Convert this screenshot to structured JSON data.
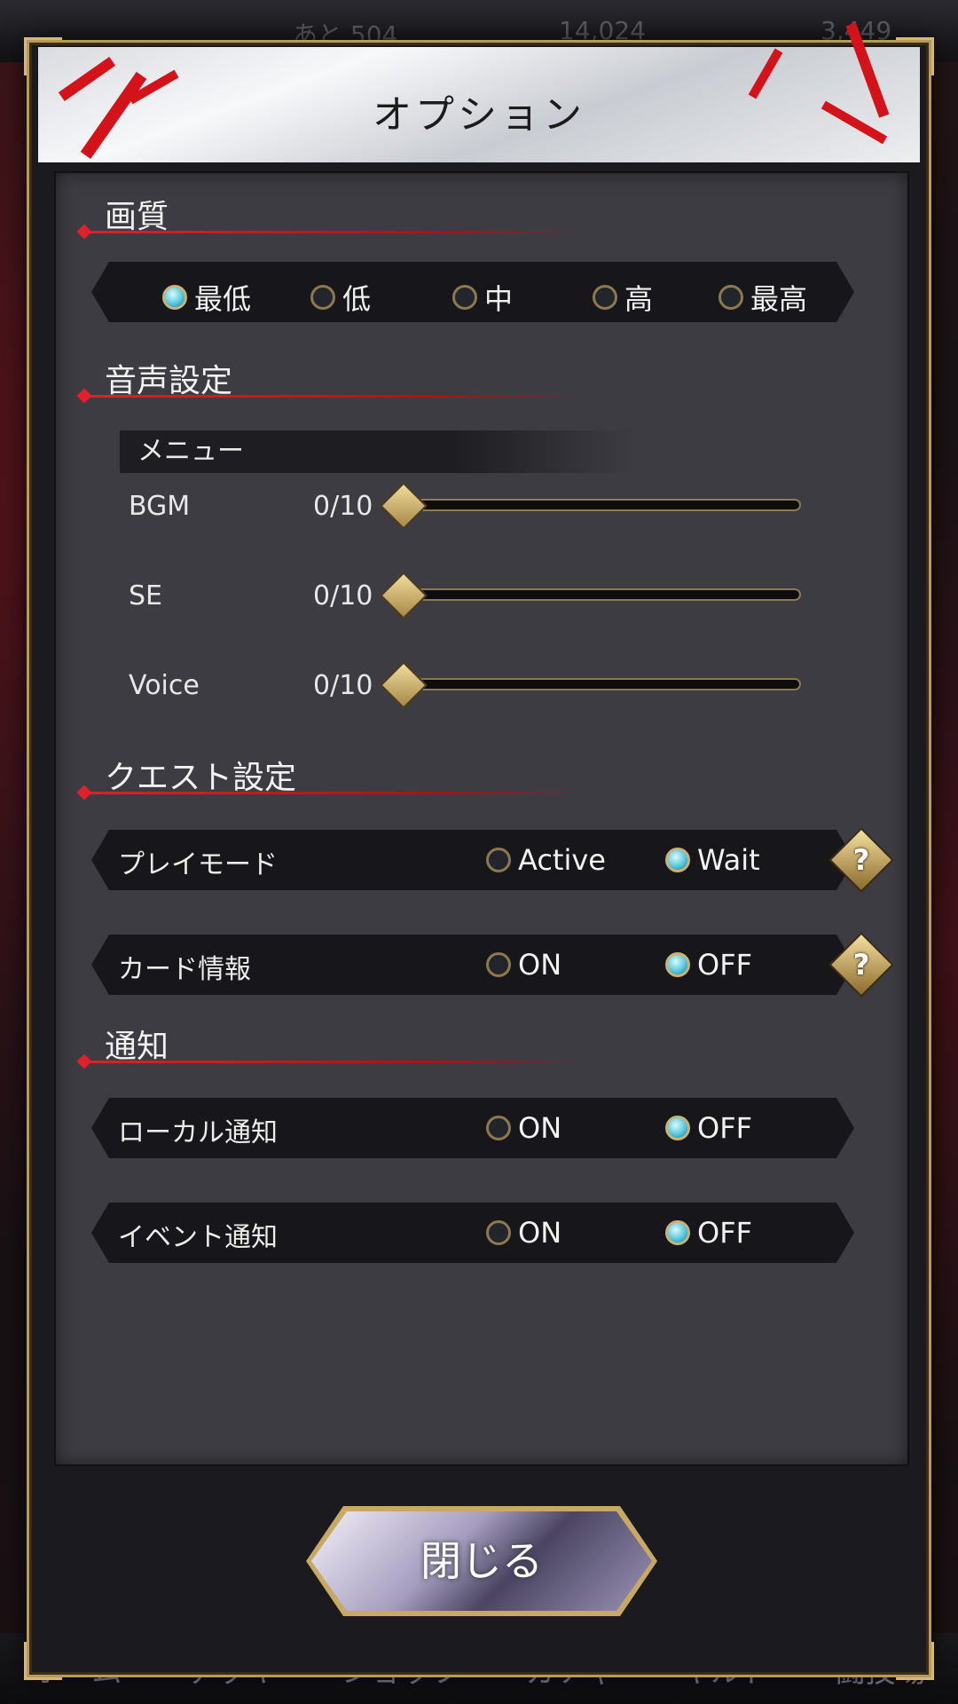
{
  "title": "オプション",
  "quality": {
    "heading": "画質",
    "options": [
      {
        "label": "最低",
        "selected": true
      },
      {
        "label": "低",
        "selected": false
      },
      {
        "label": "中",
        "selected": false
      },
      {
        "label": "高",
        "selected": false
      },
      {
        "label": "最高",
        "selected": false
      }
    ]
  },
  "audio": {
    "heading": "音声設定",
    "subheading": "メニュー",
    "sliders": [
      {
        "label": "BGM",
        "value": "0/10"
      },
      {
        "label": "SE",
        "value": "0/10"
      },
      {
        "label": "Voice",
        "value": "0/10"
      }
    ]
  },
  "quest": {
    "heading": "クエスト設定",
    "rows": [
      {
        "label": "プレイモード",
        "opt1": "Active",
        "opt2": "Wait",
        "selected": "opt2",
        "help": "?"
      },
      {
        "label": "カード情報",
        "opt1": "ON",
        "opt2": "OFF",
        "selected": "opt2",
        "help": "?"
      }
    ]
  },
  "notify": {
    "heading": "通知",
    "rows": [
      {
        "label": "ローカル通知",
        "opt1": "ON",
        "opt2": "OFF",
        "selected": "opt2"
      },
      {
        "label": "イベント通知",
        "opt1": "ON",
        "opt2": "OFF",
        "selected": "opt2"
      }
    ]
  },
  "close_label": "閉じる",
  "background": {
    "top": [
      "あと 504",
      "14,024",
      "3,449"
    ],
    "nav": [
      "ホーム",
      "デッキ",
      "ショップ",
      "ガチャ",
      "ギルド",
      "闘技場"
    ]
  }
}
